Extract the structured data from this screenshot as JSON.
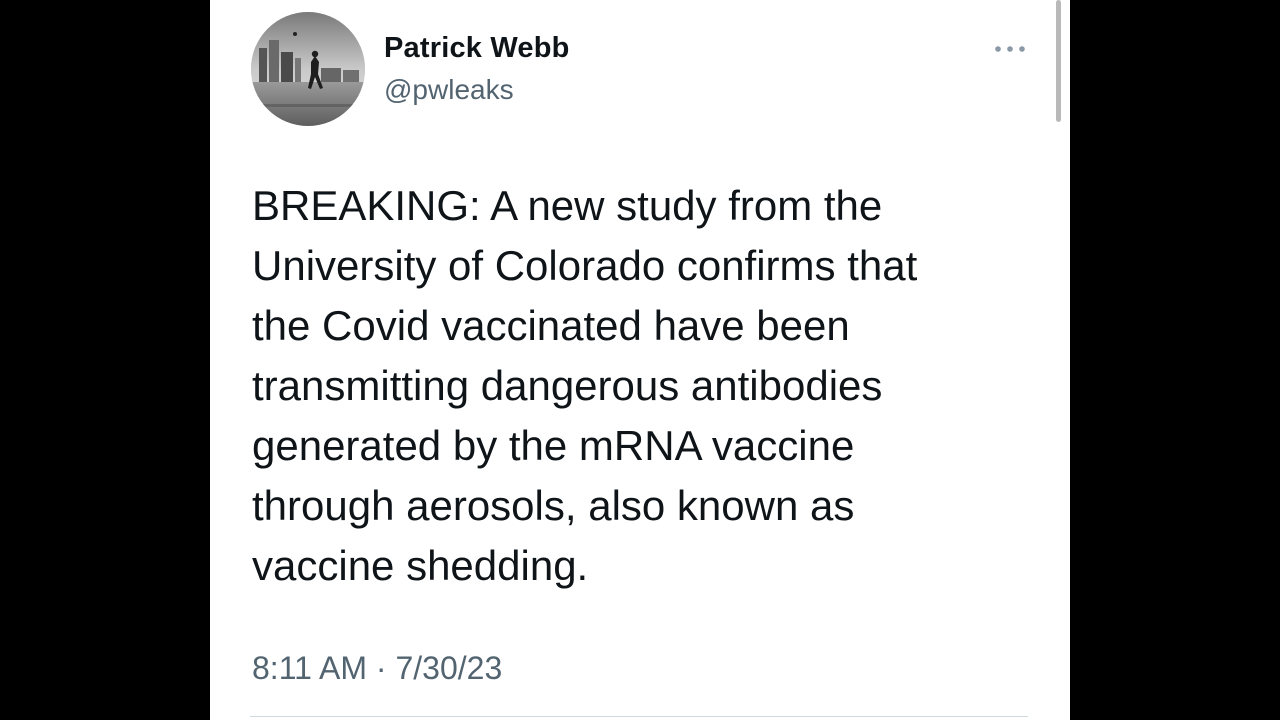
{
  "tweet": {
    "author": {
      "display_name": "Patrick Webb",
      "handle": "@pwleaks"
    },
    "more_icon": "more-horizontal-icon",
    "text_lines": [
      "BREAKING: A new study from the",
      "University of Colorado confirms that",
      "the Covid vaccinated have been",
      "transmitting dangerous antibodies",
      "generated by the mRNA vaccine",
      "through aerosols, also known as",
      "vaccine shedding."
    ],
    "time": "8:11 AM",
    "separator": " · ",
    "date": "7/30/23"
  },
  "colors": {
    "text_primary": "#0f1419",
    "text_secondary": "#536471",
    "card_background": "#ffffff",
    "page_background": "#000000"
  }
}
